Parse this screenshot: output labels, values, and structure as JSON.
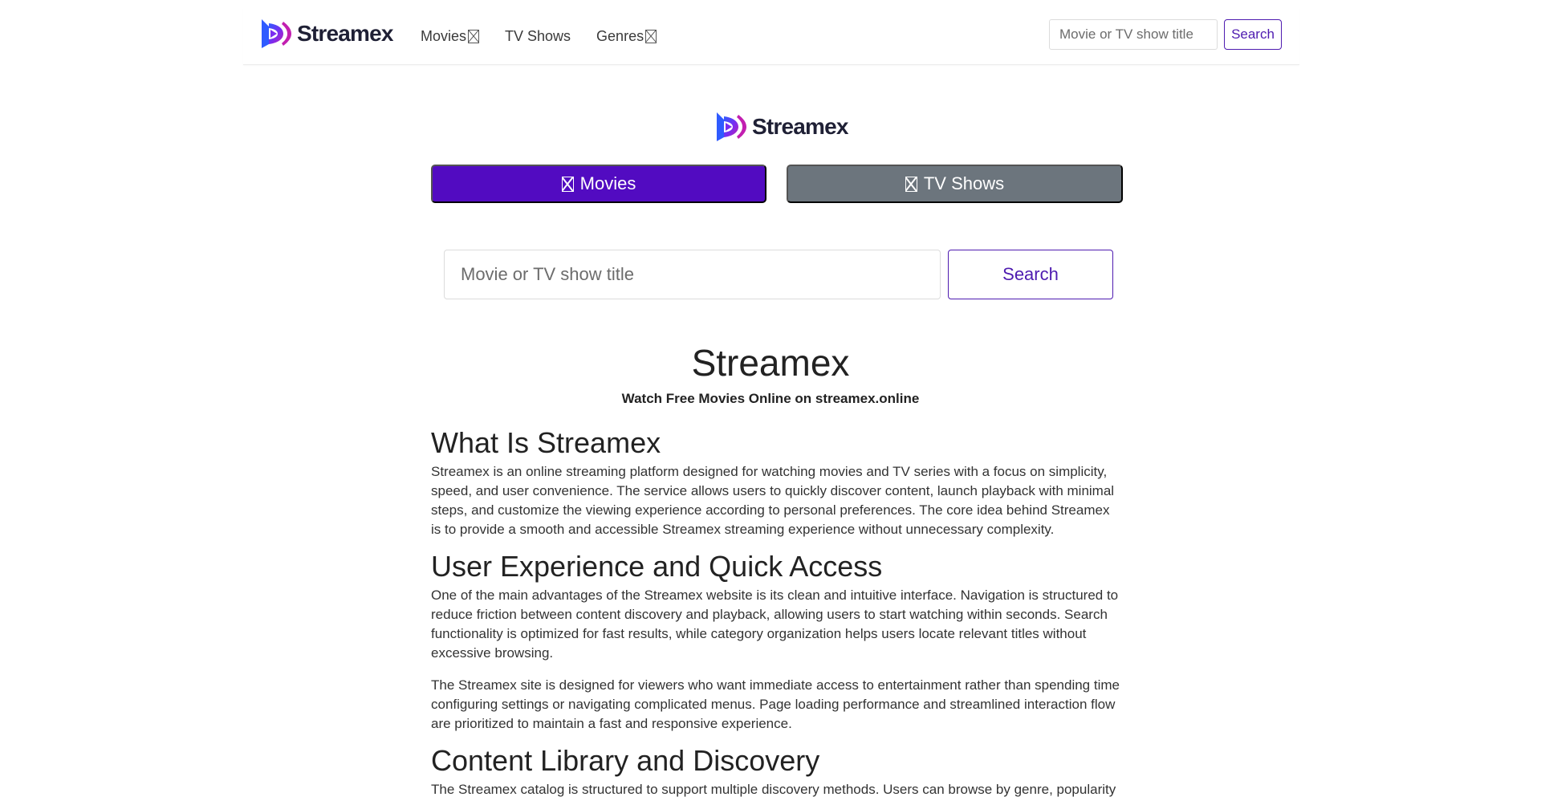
{
  "brand": {
    "name": "Streamex"
  },
  "nav": {
    "links": [
      {
        "label": "Movies",
        "has_dropdown": true
      },
      {
        "label": "TV Shows",
        "has_dropdown": false
      },
      {
        "label": "Genres",
        "has_dropdown": true
      }
    ],
    "search_placeholder": "Movie or TV show title",
    "search_button": "Search"
  },
  "toggle": {
    "movies_label": "Movies",
    "tv_label": "TV Shows",
    "active": "Movies",
    "active_color": "#520bc1",
    "inactive_color": "#6c757d"
  },
  "main_search": {
    "placeholder": "Movie or TV show title",
    "button": "Search"
  },
  "hero": {
    "title": "Streamex",
    "subtitle": "Watch Free Movies Online on streamex.online"
  },
  "sections": [
    {
      "heading": "What Is Streamex",
      "paragraphs": [
        "Streamex is an online streaming platform designed for watching movies and TV series with a focus on simplicity, speed, and user convenience. The service allows users to quickly discover content, launch playback with minimal steps, and customize the viewing experience according to personal preferences. The core idea behind Streamex is to provide a smooth and accessible Streamex streaming experience without unnecessary complexity."
      ]
    },
    {
      "heading": "User Experience and Quick Access",
      "paragraphs": [
        "One of the main advantages of the Streamex website is its clean and intuitive interface. Navigation is structured to reduce friction between content discovery and playback, allowing users to start watching within seconds. Search functionality is optimized for fast results, while category organization helps users locate relevant titles without excessive browsing.",
        "The Streamex site is designed for viewers who want immediate access to entertainment rather than spending time configuring settings or navigating complicated menus. Page loading performance and streamlined interaction flow are prioritized to maintain a fast and responsive experience."
      ]
    },
    {
      "heading": "Content Library and Discovery",
      "paragraphs": [
        "The Streamex catalog is structured to support multiple discovery methods. Users can browse by genre, popularity"
      ]
    }
  ],
  "colors": {
    "accent": "#4e1bb0",
    "brand_dark": "#1f2035"
  }
}
